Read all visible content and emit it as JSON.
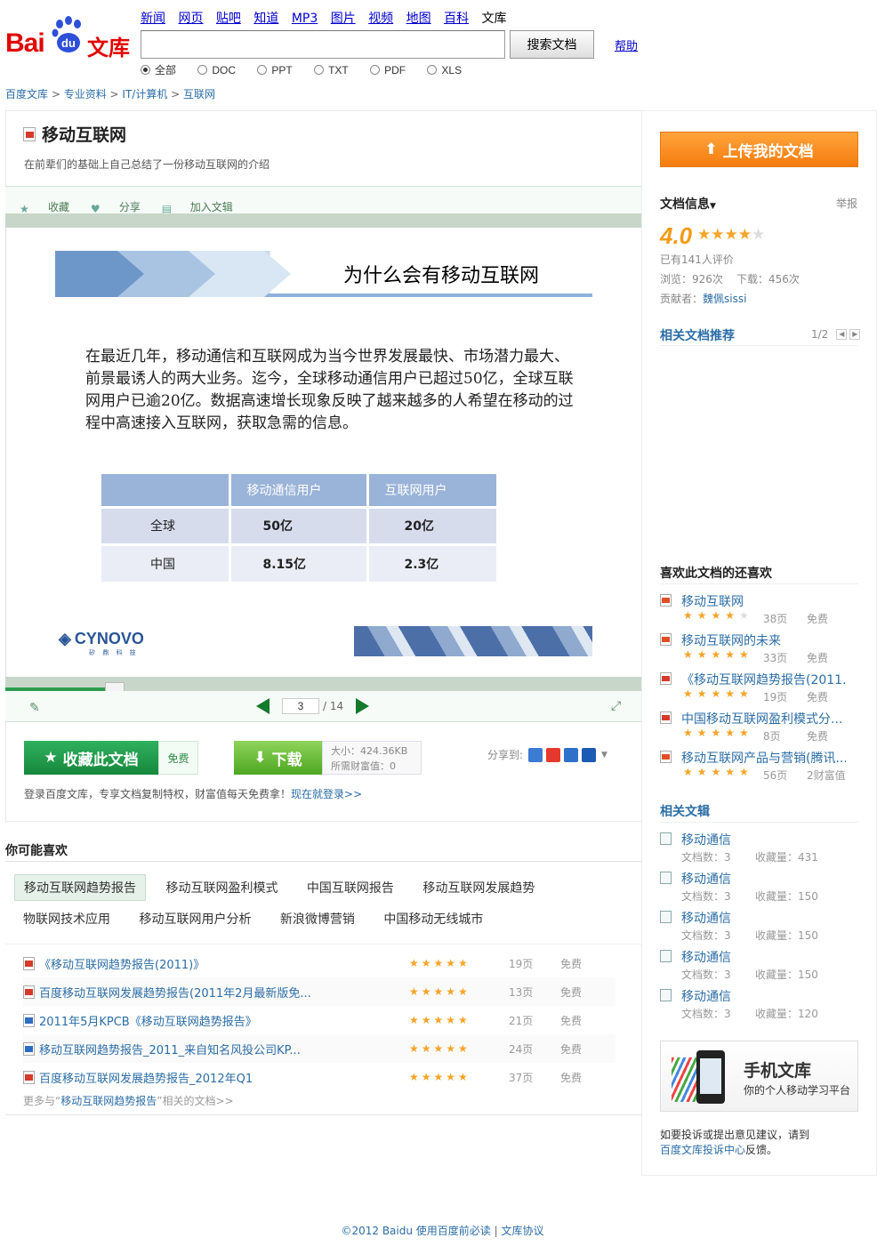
{
  "header": {
    "logo_text": "Bai",
    "logo_du": "du",
    "logo_wenku": "文库",
    "nav": [
      "新闻",
      "网页",
      "贴吧",
      "知道",
      "MP3",
      "图片",
      "视频",
      "地图",
      "百科"
    ],
    "nav_current": "文库",
    "search_value": "",
    "search_button": "搜索文档",
    "help": "帮助",
    "filters": [
      "全部",
      "DOC",
      "PPT",
      "TXT",
      "PDF",
      "XLS"
    ]
  },
  "breadcrumb": [
    "百度文库",
    "专业资料",
    "IT/计算机",
    "互联网"
  ],
  "doc": {
    "title": "移动互联网",
    "desc": "在前辈们的基础上自己总结了一份移动互联网的介绍",
    "actions": [
      "收藏",
      "分享",
      "加入文辑"
    ],
    "slide": {
      "title": "为什么会有移动互联网",
      "text": "在最近几年，移动通信和互联网成为当今世界发展最快、市场潜力最大、前景最诱人的两大业务。迄今，全球移动通信用户已超过50亿，全球互联网用户已逾20亿。数据高速增长现象反映了越来越多的人希望在移动的过程中高速接入互联网，获取急需的信息。",
      "table_headers": [
        "",
        "移动通信用户",
        "互联网用户"
      ],
      "table_rows": [
        [
          "全球",
          "50亿",
          "20亿"
        ],
        [
          "中国",
          "8.15亿",
          "2.3亿"
        ]
      ],
      "brand": "CYNOVO",
      "brand_sub": "矽 鼎 科 技"
    },
    "page_current": "3",
    "page_total": "/ 14",
    "collect_label": "收藏此文档",
    "free_label": "免费",
    "download_label": "下载",
    "size": "大小：424.36KB",
    "wealth": "所需财富值：0",
    "share_label": "分享到:",
    "login_tip": "登录百度文库，专享文档复制特权，财富值每天免费拿！",
    "login_link": "现在就登录>>"
  },
  "maylike": {
    "title": "你可能喜欢",
    "tags_row1": [
      "移动互联网趋势报告",
      "移动互联网盈利模式",
      "中国互联网报告",
      "移动互联网发展趋势"
    ],
    "tags_row2": [
      "物联网技术应用",
      "移动互联网用户分析",
      "新浪微博营销",
      "中国移动无线城市"
    ],
    "items": [
      {
        "name": "《移动互联网趋势报告(2011)》",
        "type": "pdf",
        "stars": "★★★★★",
        "pages": "19页",
        "free": "免费"
      },
      {
        "name": "百度移动互联网发展趋势报告(2011年2月最新版免...",
        "type": "pdf",
        "stars": "★★★★★",
        "pages": "13页",
        "free": "免费"
      },
      {
        "name": "2011年5月KPCB《移动互联网趋势报告》",
        "type": "doc",
        "stars": "★★★★★",
        "pages": "21页",
        "free": "免费"
      },
      {
        "name": "移动互联网趋势报告_2011_来自知名风投公司KP...",
        "type": "doc",
        "stars": "★★★★★",
        "pages": "24页",
        "free": "免费"
      },
      {
        "name": "百度移动互联网发展趋势报告_2012年Q1",
        "type": "pdf",
        "stars": "★★★★★",
        "pages": "37页",
        "free": "免费"
      }
    ],
    "more_prefix": "更多与“",
    "more_keyword": "移动互联网趋势报告",
    "more_suffix": "”相关的文档>>"
  },
  "sidebar": {
    "upload": "上传我的文档",
    "info_title": "文档信息",
    "report": "举报",
    "score": "4.0",
    "rated": "已有141人评价",
    "views": "浏览：926次",
    "downloads": "下载：456次",
    "contributor_label": "贡献者：",
    "contributor": "魏佩sissi",
    "rec_title": "相关文档推荐",
    "rec_page": "1/2",
    "also_like_title": "喜欢此文档的还喜欢",
    "also_like": [
      {
        "name": "移动互联网",
        "type": "ppt",
        "pages": "38页",
        "free": "免费"
      },
      {
        "name": "移动互联网的未来",
        "type": "ppt",
        "pages": "33页",
        "free": "免费"
      },
      {
        "name": "《移动互联网趋势报告(2011...",
        "type": "pdf",
        "pages": "19页",
        "free": "免费"
      },
      {
        "name": "中国移动互联网盈利模式分...",
        "type": "pdf",
        "pages": "8页",
        "free": "免费"
      },
      {
        "name": "移动互联网产品与营销(腾讯...",
        "type": "ppt",
        "pages": "56页",
        "free": "2财富值"
      }
    ],
    "wenji_title": "相关文辑",
    "wenji": [
      {
        "name": "移动通信",
        "count": "文档数：3",
        "fav": "收藏量：431"
      },
      {
        "name": "移动通信",
        "count": "文档数：3",
        "fav": "收藏量：150"
      },
      {
        "name": "移动通信",
        "count": "文档数：3",
        "fav": "收藏量：150"
      },
      {
        "name": "移动通信",
        "count": "文档数：3",
        "fav": "收藏量：150"
      },
      {
        "name": "移动通信",
        "count": "文档数：3",
        "fav": "收藏量：120"
      }
    ],
    "mobile_title": "手机文库",
    "mobile_sub": "你的个人移动学习平台",
    "complain_text": "如要投诉或提出意见建议，请到",
    "complain_link": "百度文库投诉中心",
    "complain_suffix": "反馈。"
  },
  "footer": {
    "copyright": "©2012 Baidu",
    "link1": "使用百度前必读",
    "link2": "文库协议"
  }
}
